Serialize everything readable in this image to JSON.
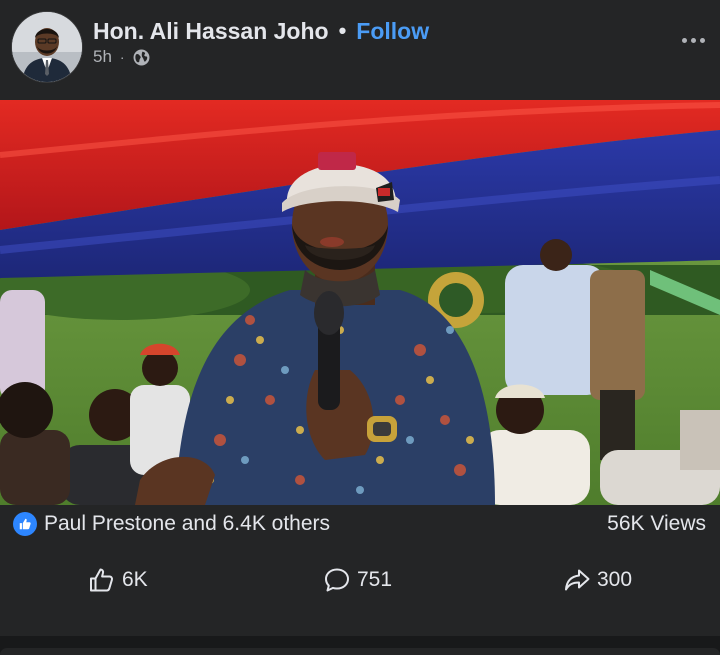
{
  "post": {
    "author": "Hon. Ali Hassan Joho",
    "separator": "•",
    "follow_label": "Follow",
    "time": "5h",
    "meta_separator": "·",
    "audience_icon": "globe-icon",
    "more_icon": "more-options-icon"
  },
  "video": {
    "description_icon": "video-frame"
  },
  "stats": {
    "reaction_icon": "like-reaction-icon",
    "reactors": "Paul Prestone and 6.4K others",
    "views": "56K Views"
  },
  "actions": {
    "like_count": "6K",
    "comment_count": "751",
    "share_count": "300"
  },
  "colors": {
    "background": "#242526",
    "text": "#e4e6eb",
    "secondary_text": "#b0b3b8",
    "follow": "#4b9cf5",
    "like_badge": "#2d86ff"
  }
}
